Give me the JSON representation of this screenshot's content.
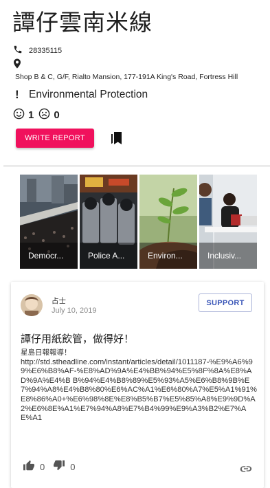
{
  "place": {
    "title": "譚仔雲南米線",
    "phone": "28335115",
    "address": "Shop B & C, G/F, Rialto Mansion, 177-191A King's Road, Fortress Hill",
    "category": "Environmental Protection",
    "likes": "1",
    "dislikes": "0",
    "write_report_label": "WRITE REPORT"
  },
  "categories": [
    {
      "label": "Democr..."
    },
    {
      "label": "Police A..."
    },
    {
      "label": "Environ..."
    },
    {
      "label": "Inclusiv..."
    }
  ],
  "report": {
    "author": "占士",
    "date": "July 10, 2019",
    "support_label": "SUPPORT",
    "title": "譚仔用紙飲管，做得好！",
    "body_heading": "星島日報報導！",
    "body_url": "http://std.stheadline.com/instant/articles/detail/1011187-%E9%A6%99%E6%B8%AF-%E8%AD%9A%E4%BB%94%E5%8F%8A%E8%AD%9A%E4%B B%94%E4%B8%89%E5%93%A5%E6%B8%9B%E7%94%A8%E4%B8%80%E6%AC%A1%E6%80%A7%E5%A1%91%E8%86%A0+%E6%98%8E%E8%B5%B7%E5%85%A8%E9%9D%A2%E6%8E%A1%E7%94%A8%E7%B4%99%E9%A3%B2%E7%AE%A1",
    "upvotes": "0",
    "downvotes": "0"
  },
  "colors": {
    "accent": "#f0115d",
    "support": "#3b57b8"
  },
  "icons": [
    "phone-icon",
    "location-pin-icon",
    "exclamation-icon",
    "smile-icon",
    "frown-icon",
    "bookmarks-icon",
    "thumb-up-icon",
    "thumb-down-icon",
    "link-icon"
  ]
}
